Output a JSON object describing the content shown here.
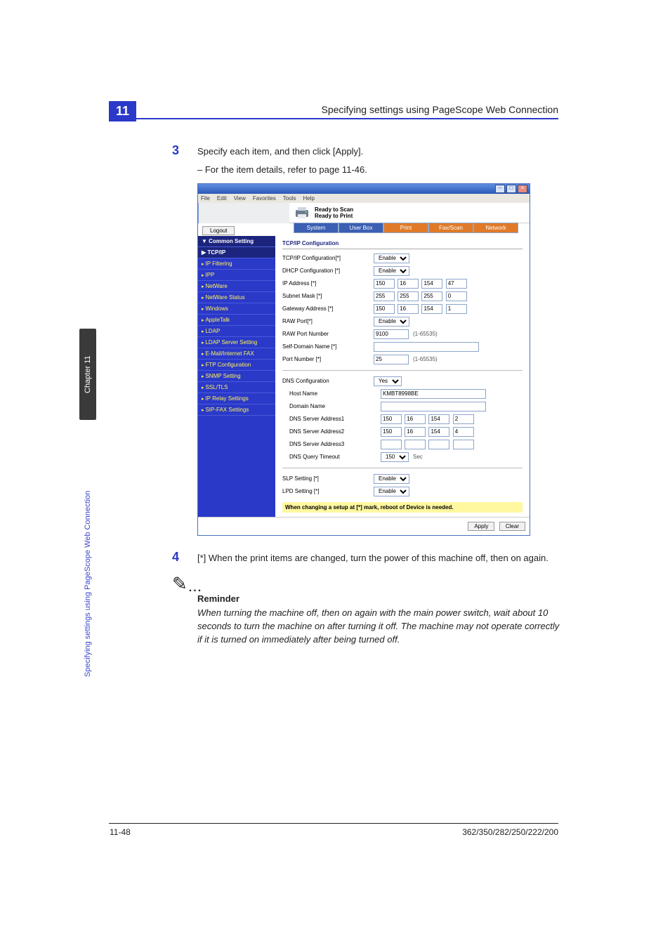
{
  "meta": {
    "section_number": "11",
    "header_title": "Specifying settings using PageScope Web Connection",
    "footer_page": "11-48",
    "footer_models": "362/350/282/250/222/200"
  },
  "side": {
    "chapter": "Chapter 11",
    "section": "Specifying settings using PageScope Web Connection"
  },
  "steps": {
    "s3": {
      "num": "3",
      "text": "Specify each item, and then click [Apply].",
      "sub": "–   For the item details, refer to page 11-46."
    },
    "s4": {
      "num": "4",
      "text": "[*] When the print items are changed, turn the power of this machine off, then on again."
    }
  },
  "reminder": {
    "dots": "...",
    "title": "Reminder",
    "body": "When turning the machine off, then on again with the main power switch, wait about 10 seconds to turn the machine on after turning it off. The machine may not operate correctly if it is turned on immediately after being turned off."
  },
  "window": {
    "title": " ",
    "menu": [
      "File",
      "Edit",
      "View",
      "Favorites",
      "Tools",
      "Help"
    ],
    "status1": "Ready to Scan",
    "status2": "Ready to Print",
    "logout": "Logout",
    "tabs": [
      "System",
      "User Box",
      "Print",
      "Fax/Scan",
      "Network"
    ],
    "side_head": "▼ Common Setting",
    "side_sel": "▶ TCP/IP",
    "side_items": [
      "IP Filtering",
      "IPP",
      "NetWare",
      "NetWare Status",
      "Windows",
      "AppleTalk",
      "LDAP",
      "LDAP Server Setting",
      "E-Mail/Internet FAX",
      "FTP Configuration",
      "SNMP Setting",
      "SSL/TLS",
      "IP Relay Settings",
      "SIP-FAX Settings"
    ],
    "panel_title": "TCP/IP Configuration",
    "fields": {
      "tcpip_conf": {
        "label": "TCP/IP Configuration[*]",
        "value": "Enable"
      },
      "dhcp_conf": {
        "label": "DHCP Configuration [*]",
        "value": "Enable"
      },
      "ip_addr": {
        "label": "IP Address [*]",
        "v": [
          "150",
          "16",
          "154",
          "47"
        ]
      },
      "subnet": {
        "label": "Subnet Mask [*]",
        "v": [
          "255",
          "255",
          "255",
          "0"
        ]
      },
      "gateway": {
        "label": "Gateway Address [*]",
        "v": [
          "150",
          "16",
          "154",
          "1"
        ]
      },
      "raw_port": {
        "label": "RAW Port[*]",
        "value": "Enable"
      },
      "raw_port_num": {
        "label": "RAW Port Number",
        "value": "9100",
        "hint": "(1-65535)"
      },
      "self_domain": {
        "label": "Self-Domain Name [*]",
        "value": ""
      },
      "port_number": {
        "label": "Port Number [*]",
        "value": "25",
        "hint": "(1-65535)"
      },
      "dns_conf": {
        "label": "DNS Configuration",
        "value": "Yes"
      },
      "host_name": {
        "label": "Host Name",
        "value": "KMBT8998BE"
      },
      "domain_name": {
        "label": "Domain Name",
        "value": ""
      },
      "dns1": {
        "label": "DNS Server Address1",
        "v": [
          "150",
          "16",
          "154",
          "2"
        ]
      },
      "dns2": {
        "label": "DNS Server Address2",
        "v": [
          "150",
          "16",
          "154",
          "4"
        ]
      },
      "dns3": {
        "label": "DNS Server Address3",
        "v": [
          "",
          "",
          "",
          ""
        ]
      },
      "dns_timeout": {
        "label": "DNS Query Timeout",
        "value": "150",
        "unit": "Sec"
      },
      "slp": {
        "label": "SLP Setting [*]",
        "value": "Enable"
      },
      "lpd": {
        "label": "LPD Setting [*]",
        "value": "Enable"
      }
    },
    "warn": "When changing a setup at [*] mark, reboot of Device is needed.",
    "apply": "Apply",
    "clear": "Clear"
  }
}
